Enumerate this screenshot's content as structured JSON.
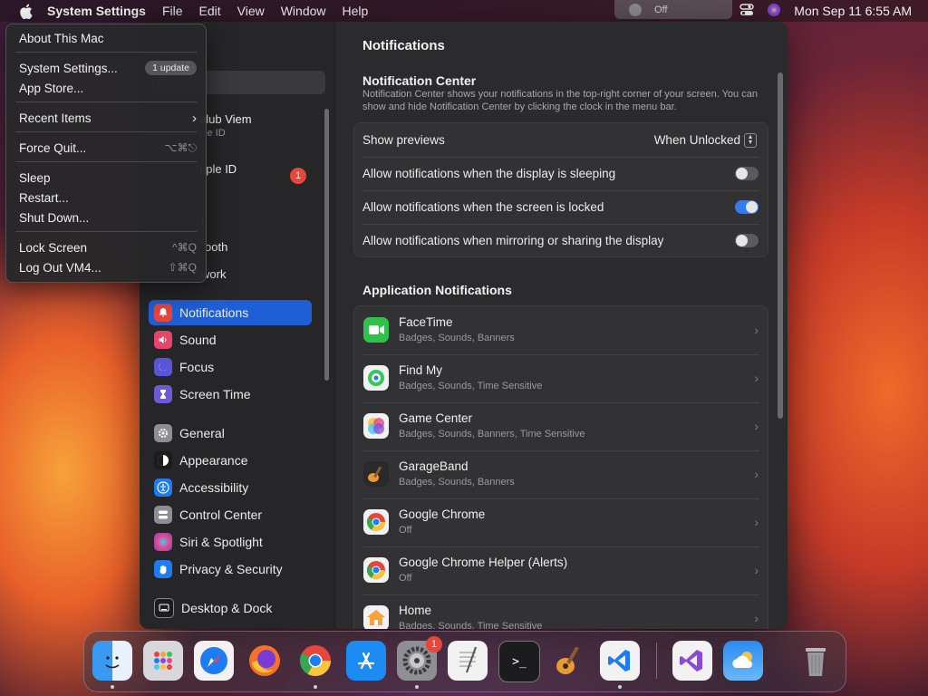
{
  "menubar": {
    "app_name": "System Settings",
    "menus": [
      "File",
      "Edit",
      "View",
      "Window",
      "Help"
    ],
    "focus_status": "Off",
    "datetime": "Mon Sep 11  6:55 AM"
  },
  "apple_menu": {
    "about": "About This Mac",
    "system_settings": "System Settings...",
    "update_badge": "1 update",
    "app_store": "App Store...",
    "recent_items": "Recent Items",
    "force_quit": "Force Quit...",
    "force_quit_shortcut": "⌥⌘⎋",
    "sleep": "Sleep",
    "restart": "Restart...",
    "shut_down": "Shut Down...",
    "lock_screen": "Lock Screen",
    "lock_screen_shortcut": "^⌘Q",
    "log_out": "Log Out VM4...",
    "log_out_shortcut": "⇧⌘Q"
  },
  "sidebar": {
    "search_placeholder": "n",
    "profile_name": "alub Viem",
    "profile_sub": "ple ID",
    "apple_id": "pple ID",
    "apple_id_badge": "1",
    "partial_wifi": "i",
    "partial_bluetooth": "ooth",
    "partial_network": "work",
    "items": [
      {
        "label": "Notifications",
        "icon": "bell-icon",
        "color": "#e8453c"
      },
      {
        "label": "Sound",
        "icon": "speaker-icon",
        "color": "#e8456a"
      },
      {
        "label": "Focus",
        "icon": "moon-icon",
        "color": "#5856d6"
      },
      {
        "label": "Screen Time",
        "icon": "hourglass-icon",
        "color": "#6b5bd6"
      },
      {
        "label": "General",
        "icon": "gear-icon",
        "color": "#8e8e93"
      },
      {
        "label": "Appearance",
        "icon": "appearance-icon",
        "color": "#1c1c1e"
      },
      {
        "label": "Accessibility",
        "icon": "accessibility-icon",
        "color": "#1d7cf2"
      },
      {
        "label": "Control Center",
        "icon": "control-center-icon",
        "color": "#8e8e93"
      },
      {
        "label": "Siri & Spotlight",
        "icon": "siri-icon",
        "color": "#6a4ad6"
      },
      {
        "label": "Privacy & Security",
        "icon": "hand-icon",
        "color": "#1d7cf2"
      },
      {
        "label": "Desktop & Dock",
        "icon": "desktop-icon",
        "color": "#1c1c1e"
      }
    ]
  },
  "content": {
    "title": "Notifications",
    "nc_title": "Notification Center",
    "nc_desc": "Notification Center shows your notifications in the top-right corner of your screen. You can show and hide Notification Center by clicking the clock in the menu bar.",
    "show_previews_label": "Show previews",
    "show_previews_value": "When Unlocked",
    "toggle_rows": [
      {
        "label": "Allow notifications when the display is sleeping",
        "on": false
      },
      {
        "label": "Allow notifications when the screen is locked",
        "on": true
      },
      {
        "label": "Allow notifications when mirroring or sharing the display",
        "on": false
      }
    ],
    "app_notifications_title": "Application Notifications",
    "apps": [
      {
        "name": "FaceTime",
        "sub": "Badges, Sounds, Banners",
        "icon": "facetime-icon"
      },
      {
        "name": "Find My",
        "sub": "Badges, Sounds, Time Sensitive",
        "icon": "find-my-icon"
      },
      {
        "name": "Game Center",
        "sub": "Badges, Sounds, Banners, Time Sensitive",
        "icon": "game-center-icon"
      },
      {
        "name": "GarageBand",
        "sub": "Badges, Sounds, Banners",
        "icon": "garageband-icon"
      },
      {
        "name": "Google Chrome",
        "sub": "Off",
        "icon": "chrome-icon"
      },
      {
        "name": "Google Chrome Helper (Alerts)",
        "sub": "Off",
        "icon": "chrome-icon"
      },
      {
        "name": "Home",
        "sub": "Badges, Sounds, Time Sensitive",
        "icon": "home-icon"
      }
    ]
  },
  "dock": {
    "settings_badge": "1",
    "apps": [
      "finder-icon",
      "launchpad-icon",
      "safari-icon",
      "firefox-icon",
      "chrome-icon",
      "app-store-icon",
      "system-settings-icon",
      "textedit-icon",
      "terminal-icon",
      "garageband-icon",
      "vscode-icon",
      "visual-studio-icon",
      "weather-icon",
      "trash-icon"
    ]
  }
}
